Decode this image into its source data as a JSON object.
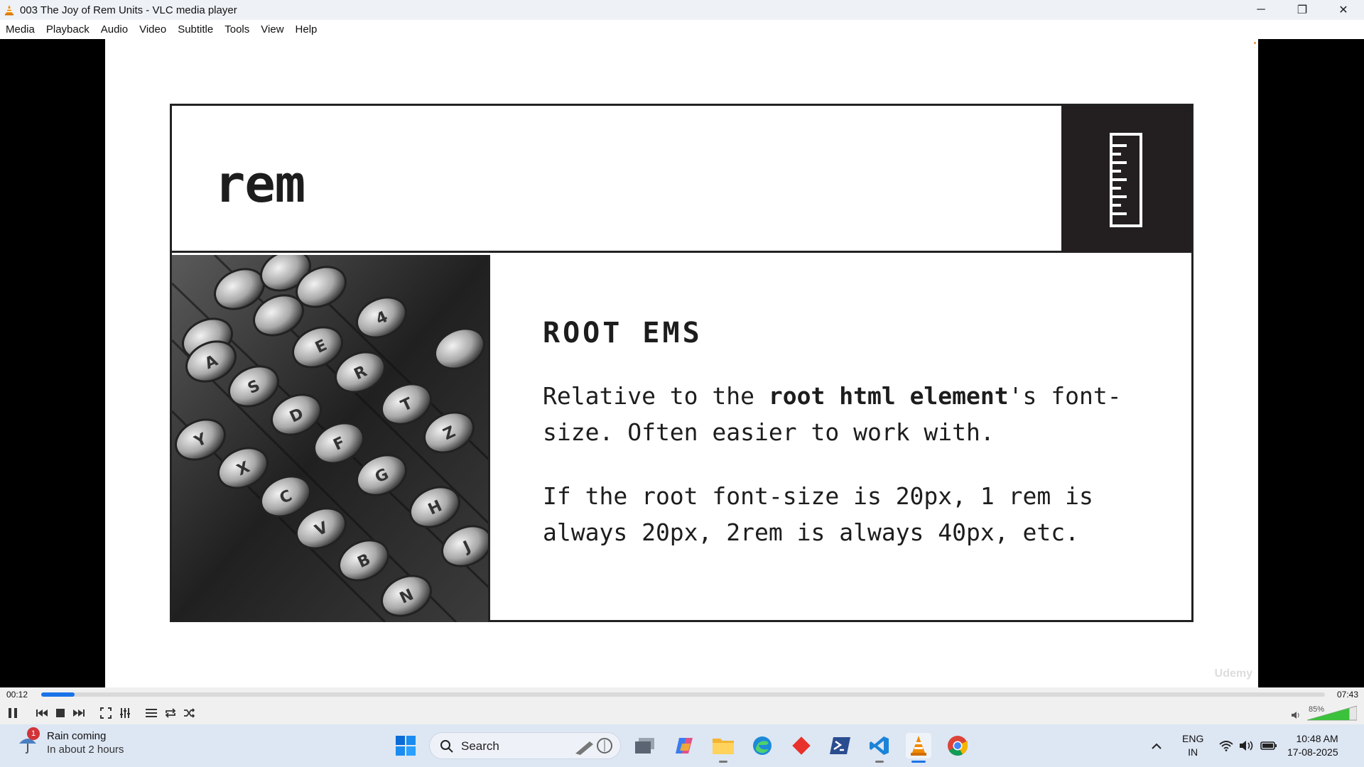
{
  "window": {
    "title": "003 The Joy of Rem Units - VLC media player",
    "minimize_glyph": "─",
    "restore_glyph": "❐",
    "close_glyph": "✕"
  },
  "menu": [
    "Media",
    "Playback",
    "Audio",
    "Video",
    "Subtitle",
    "Tools",
    "View",
    "Help"
  ],
  "slide": {
    "heading": "rem",
    "subheading": "ROOT EMS",
    "para1_a": "Relative to the ",
    "para1_bold": "root html element",
    "para1_b": "'s font-size. Often easier to work with.",
    "para2": "If the root font-size is 20px, 1 rem is always 20px, 2rem is always 40px, etc.",
    "watermark": "Udemy",
    "ruler_icon": "ruler-icon",
    "image": "typewriter-keys-photo"
  },
  "player": {
    "elapsed": "00:12",
    "total": "07:43",
    "progress_fraction": 0.026,
    "volume_percent": "85%",
    "volume_fraction": 0.85,
    "accent": "#1a73e8"
  },
  "taskbar": {
    "weather_title": "Rain coming",
    "weather_sub": "In about 2 hours",
    "weather_badge": "1",
    "search_label": "Search",
    "lang_line1": "ENG",
    "lang_line2": "IN",
    "time": "10:48 AM",
    "date": "17-08-2025"
  }
}
